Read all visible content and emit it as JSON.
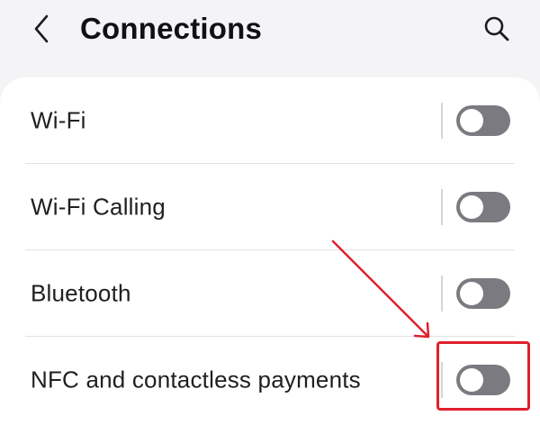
{
  "header": {
    "back_icon": "chevron-left-icon",
    "title": "Connections",
    "search_icon": "search-icon"
  },
  "settings": [
    {
      "label": "Wi-Fi",
      "enabled": false
    },
    {
      "label": "Wi-Fi Calling",
      "enabled": false
    },
    {
      "label": "Bluetooth",
      "enabled": false
    },
    {
      "label": "NFC and contactless payments",
      "enabled": false
    }
  ],
  "annotation": {
    "highlight_color": "#e0202c",
    "target": "NFC and contactless payments toggle"
  },
  "colors": {
    "background": "#f4f4f6",
    "card": "#ffffff",
    "toggle_off": "#7a7a80",
    "text": "#1f1f23"
  }
}
